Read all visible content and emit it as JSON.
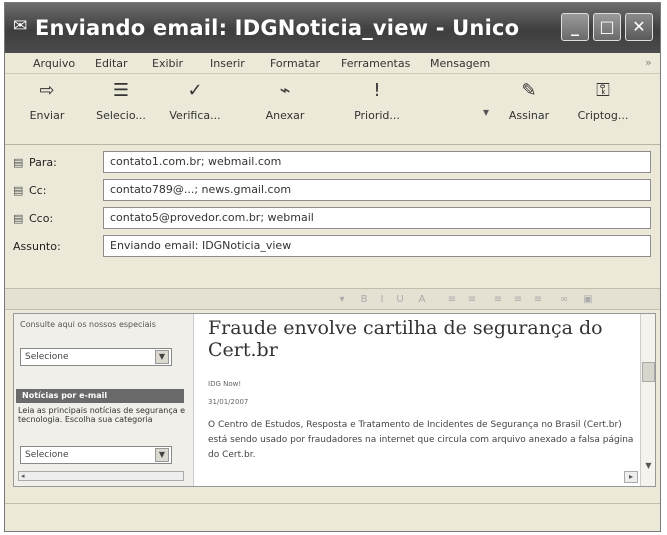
{
  "window": {
    "title": "Enviando email: IDGNoticia_view - Unico",
    "app_icon": "envelope-icon"
  },
  "menubar": {
    "items": [
      "Arquivo",
      "Editar",
      "Exibir",
      "Inserir",
      "Formatar",
      "Ferramentas",
      "Mensagem"
    ]
  },
  "toolbar": {
    "buttons": [
      {
        "label": "Enviar",
        "icon": "send-icon"
      },
      {
        "label": "Selecio...",
        "icon": "select-icon"
      },
      {
        "label": "Verifica...",
        "icon": "spellcheck-icon"
      },
      {
        "label": "Anexar",
        "icon": "attach-icon"
      },
      {
        "label": "Priorid...",
        "icon": "priority-icon"
      },
      {
        "label": "Assinar",
        "icon": "sign-icon"
      },
      {
        "label": "Criptog...",
        "icon": "encrypt-icon"
      }
    ]
  },
  "headers": {
    "to_label": "Para:",
    "to_value": "contato1.com.br; webmail.com",
    "cc_label": "Cc:",
    "cc_value": "contato789@...; news.gmail.com",
    "bcc_label": "Cco:",
    "bcc_value": "contato5@provedor.com.br; webmail",
    "subject_label": "Assunto:",
    "subject_value": "Enviando email: IDGNoticia_view"
  },
  "compose": {
    "sidebar": {
      "caption": "Consulte aqui os nossos especiais",
      "select_value": "Selecione",
      "section_header": "Notícias por e-mail",
      "description": "Leia as principais notícias de segurança e tecnologia. Escolha sua categoria",
      "select2_value": "Selecione"
    },
    "article": {
      "title_line1": "Fraude envolve cartilha de segurança do",
      "title_line2": "Cert.br",
      "meta_author": "IDG Now!",
      "meta_date": "31/01/2007",
      "body": "O Centro de Estudos, Resposta e Tratamento de Incidentes de Segurança no Brasil (Cert.br) está sendo usado por fraudadores na internet que circula com arquivo anexado a falsa página do Cert.br."
    }
  }
}
